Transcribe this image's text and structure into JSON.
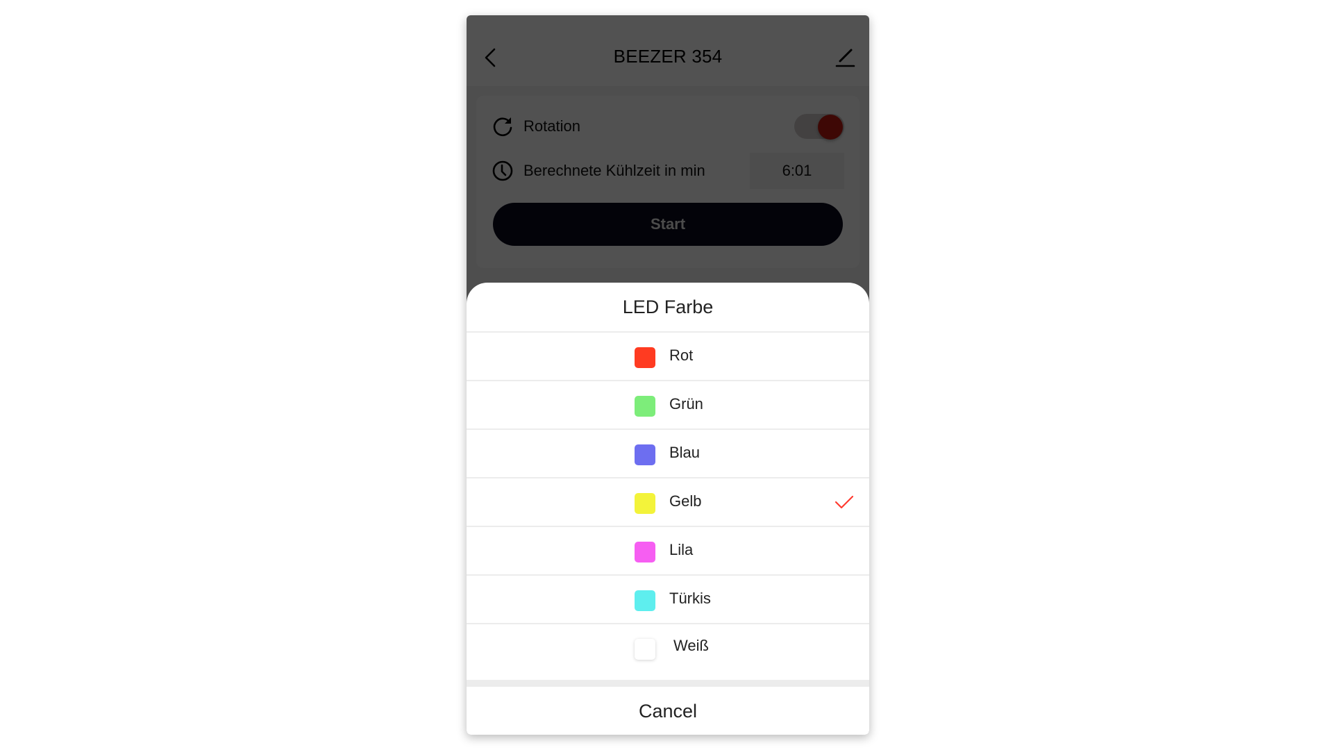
{
  "screen": {
    "header": {
      "title": "BEEZER 354",
      "back_icon": "chevron-left-icon",
      "edit_icon": "pencil-icon"
    },
    "settings": {
      "rotation": {
        "icon": "rotate-icon",
        "label": "Rotation",
        "enabled": true,
        "toggle_color": "#c21a10"
      },
      "cooling_time": {
        "icon": "clock-icon",
        "label": "Berechnete Kühlzeit in min",
        "value": "6:01"
      },
      "start_label": "Start"
    }
  },
  "action_sheet": {
    "title": "LED Farbe",
    "selected": "Gelb",
    "accent_color": "#ff3b30",
    "options": [
      {
        "label": "Rot",
        "color": "#ff3b21",
        "selected": false
      },
      {
        "label": "Grün",
        "color": "#7ded7a",
        "selected": false
      },
      {
        "label": "Blau",
        "color": "#6d6ef0",
        "selected": false
      },
      {
        "label": "Gelb",
        "color": "#f3f33a",
        "selected": true
      },
      {
        "label": "Lila",
        "color": "#f65ef2",
        "selected": false
      },
      {
        "label": "Türkis",
        "color": "#5eeeee",
        "selected": false
      },
      {
        "label": "Weiß",
        "color": "#ffffff",
        "selected": false
      }
    ],
    "cancel_label": "Cancel"
  }
}
